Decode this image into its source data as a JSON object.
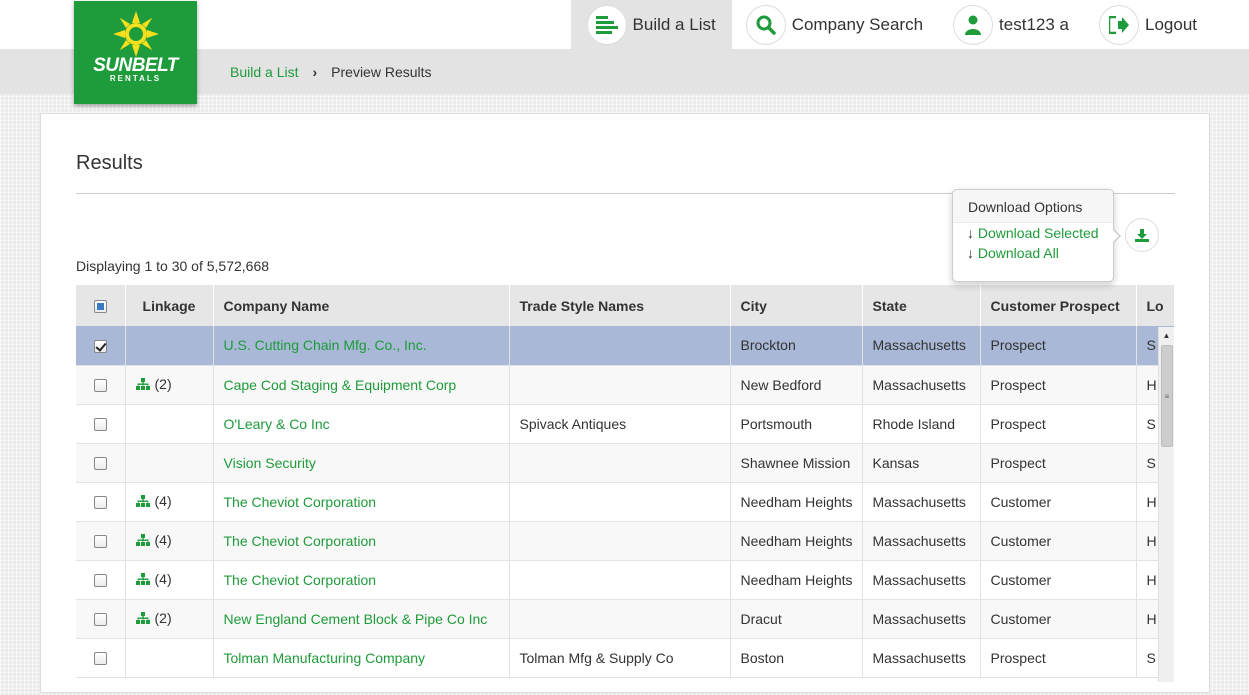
{
  "brand": {
    "name": "SUNBELT",
    "sub": "RENTALS"
  },
  "nav": {
    "build_list": "Build a List",
    "company_search": "Company Search",
    "user": "test123 a",
    "logout": "Logout"
  },
  "breadcrumb": {
    "link": "Build a List",
    "current": "Preview Results"
  },
  "results": {
    "title": "Results",
    "displaying": "Displaying 1 to 30 of 5,572,668"
  },
  "download": {
    "header": "Download Options",
    "selected": "Download Selected",
    "all": "Download All"
  },
  "table": {
    "columns": [
      "Linkage",
      "Company Name",
      "Trade Style Names",
      "City",
      "State",
      "Customer Prospect",
      "Lo"
    ],
    "rows": [
      {
        "checked": true,
        "linkage": "",
        "name": "U.S. Cutting Chain Mfg. Co., Inc.",
        "trade": "",
        "city": "Brockton",
        "state": "Massachusetts",
        "cp": "Prospect",
        "loc": "S"
      },
      {
        "checked": false,
        "linkage": "(2)",
        "name": "Cape Cod Staging & Equipment Corp",
        "trade": "",
        "city": "New Bedford",
        "state": "Massachusetts",
        "cp": "Prospect",
        "loc": "H"
      },
      {
        "checked": false,
        "linkage": "",
        "name": "O'Leary & Co Inc",
        "trade": "Spivack Antiques",
        "city": "Portsmouth",
        "state": "Rhode Island",
        "cp": "Prospect",
        "loc": "S"
      },
      {
        "checked": false,
        "linkage": "",
        "name": "Vision Security",
        "trade": "",
        "city": "Shawnee Mission",
        "state": "Kansas",
        "cp": "Prospect",
        "loc": "S"
      },
      {
        "checked": false,
        "linkage": "(4)",
        "name": "The Cheviot Corporation",
        "trade": "",
        "city": "Needham Heights",
        "state": "Massachusetts",
        "cp": "Customer",
        "loc": "H"
      },
      {
        "checked": false,
        "linkage": "(4)",
        "name": "The Cheviot Corporation",
        "trade": "",
        "city": "Needham Heights",
        "state": "Massachusetts",
        "cp": "Customer",
        "loc": "H"
      },
      {
        "checked": false,
        "linkage": "(4)",
        "name": "The Cheviot Corporation",
        "trade": "",
        "city": "Needham Heights",
        "state": "Massachusetts",
        "cp": "Customer",
        "loc": "H"
      },
      {
        "checked": false,
        "linkage": "(2)",
        "name": "New England Cement Block & Pipe Co Inc",
        "trade": "",
        "city": "Dracut",
        "state": "Massachusetts",
        "cp": "Customer",
        "loc": "H"
      },
      {
        "checked": false,
        "linkage": "",
        "name": "Tolman Manufacturing Company",
        "trade": "Tolman Mfg & Supply Co",
        "city": "Boston",
        "state": "Massachusetts",
        "cp": "Prospect",
        "loc": "S"
      }
    ]
  },
  "colors": {
    "accent": "#1e9b3a",
    "selected_row": "#a8b8d6"
  }
}
